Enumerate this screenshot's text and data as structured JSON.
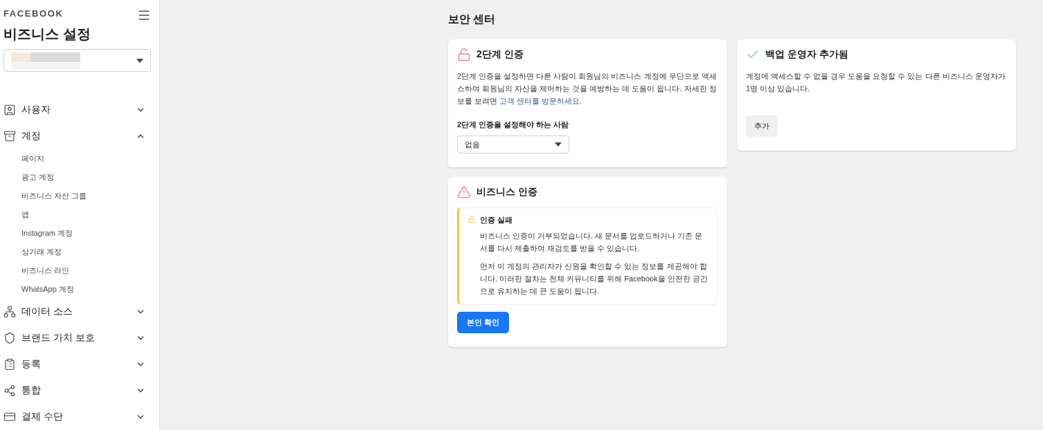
{
  "sidebar": {
    "brand": "FACEBOOK",
    "title": "비즈니스 설정",
    "nav": [
      {
        "label": "사용자",
        "expanded": false
      },
      {
        "label": "계정",
        "expanded": true,
        "children": [
          {
            "label": "페이지"
          },
          {
            "label": "광고 계정"
          },
          {
            "label": "비즈니스 자산 그룹"
          },
          {
            "label": "앱"
          },
          {
            "label": "Instagram 계정"
          },
          {
            "label": "상거래 계정"
          },
          {
            "label": "비즈니스 라인"
          },
          {
            "label": "WhatsApp 계정"
          }
        ]
      },
      {
        "label": "데이터 소스",
        "expanded": false
      },
      {
        "label": "브랜드 가치 보호",
        "expanded": false
      },
      {
        "label": "등록",
        "expanded": false
      },
      {
        "label": "통합",
        "expanded": false
      },
      {
        "label": "결제 수단",
        "expanded": false
      }
    ]
  },
  "main": {
    "title": "보안 센터",
    "two_factor": {
      "title": "2단계 인증",
      "description": "2단계 인증을 설정하면 다른 사람이 회원님의 비즈니스 계정에 무단으로 액세스하여 회원님의 자산을 제어하는 것을 예방하는 데 도움이 됩니다. 자세한 정보를 보려면 ",
      "link": "고객 센터를 방문하세요.",
      "field_label": "2단계 인증을 설정해야 하는 사람",
      "select_value": "없음"
    },
    "business_verification": {
      "title": "비즈니스 인증",
      "alert": {
        "title": "인증 실패",
        "paragraphs": [
          "비즈니스 인증이 거부되었습니다. 새 문서를 업로드하거나 기존 문서를 다시 제출하여 재검토를 받을 수 있습니다.",
          "먼저 이 계정의 관리자가 신원을 확인할 수 있는 정보를 제공해야 합니다. 이러한 절차는 전체 커뮤니티를 위해 Facebook을 안전한 공간으로 유지하는 데 큰 도움이 됩니다."
        ]
      },
      "button": "본인 확인"
    },
    "backup_admin": {
      "title": "백업 운영자 추가됨",
      "description": "계정에 액세스할 수 없을 경우 도움을 요청할 수 있는 다른 비즈니스 운영자가 1명 이상 있습니다.",
      "button": "추가"
    }
  }
}
